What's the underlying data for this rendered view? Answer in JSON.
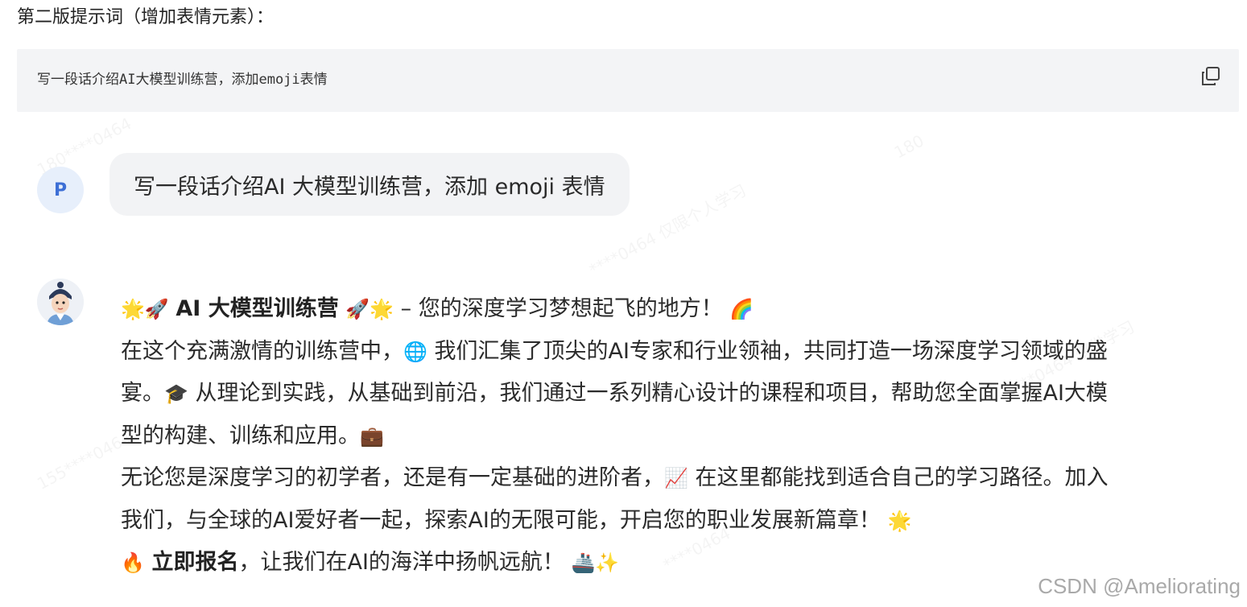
{
  "heading": "第二版提示词（增加表情元素）：",
  "code_block": {
    "text": "写一段话介绍AI大模型训练营，添加emoji表情",
    "copy_icon": "copy-icon"
  },
  "user": {
    "avatar_letter": "P",
    "message": "写一段话介绍AI 大模型训练营，添加 emoji 表情"
  },
  "bot": {
    "title_emoji_left": "🌟🚀",
    "title_bold": "AI 大模型训练营",
    "title_emoji_right": "🚀🌟",
    "title_rest": " – 您的深度学习梦想起飞的地方！",
    "title_emoji_end": "🌈",
    "p1_line1_a": "在这个充满激情的训练营中，",
    "p1_line1_emoji": "🌐",
    "p1_line1_b": " 我们汇集了顶尖的AI专家和行业领袖，共同打造一场深度学习领域的盛",
    "p1_line2_a": "宴。",
    "p1_line2_emoji": "🎓",
    "p1_line2_b": " 从理论到实践，从基础到前沿，我们通过一系列精心设计的课程和项目，帮助您全面掌握AI大模",
    "p1_line3_a": "型的构建、训练和应用。",
    "p1_line3_emoji": "💼",
    "p2_line1_a": "无论您是深度学习的初学者，还是有一定基础的进阶者，",
    "p2_line1_emoji": "📈",
    "p2_line1_b": " 在这里都能找到适合自己的学习路径。加入",
    "p2_line2_a": "我们，与全球的AI爱好者一起，探索AI的无限可能，开启您的职业发展新篇章！",
    "p2_line2_emoji": "🌟",
    "p3_emoji": "🔥",
    "p3_bold": "立即报名",
    "p3_rest": "，让我们在AI的海洋中扬帆远航！",
    "p3_emoji_end": "🚢✨"
  },
  "csdn_watermark": "CSDN @Ameliorating"
}
